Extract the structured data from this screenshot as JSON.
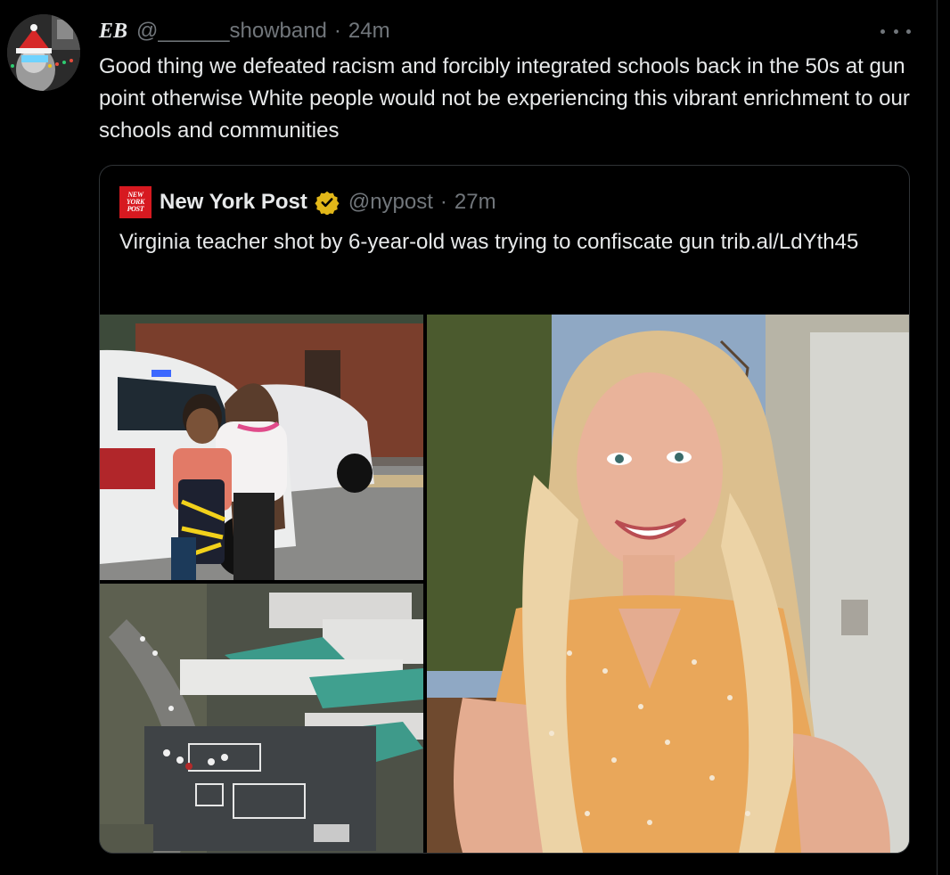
{
  "tweet": {
    "display_name": "EB",
    "handle": "@______showband",
    "separator": "·",
    "time": "24m",
    "text": "Good thing we defeated racism and forcibly integrated schools back in the 50s at gun point otherwise White people would not be experiencing this vibrant enrichment to our schools and communities",
    "avatar_icon": "user-avatar-santa-hat"
  },
  "quote": {
    "display_name": "New York Post",
    "logo_lines": [
      "NEW",
      "YORK",
      "POST"
    ],
    "verified_icon": "verified-badge-icon",
    "handle": "@nypost",
    "separator": "·",
    "time": "27m",
    "text": "Virginia teacher shot by 6-year-old was trying to confiscate gun trib.al/LdYth45"
  },
  "media": [
    {
      "name": "police-scene-photo"
    },
    {
      "name": "school-aerial-photo"
    },
    {
      "name": "teacher-portrait-photo"
    }
  ],
  "colors": {
    "background": "#000000",
    "text_primary": "#e7e9ea",
    "text_secondary": "#71767b",
    "border": "#2f3336",
    "nypost_red": "#d71920",
    "verified_gold": "#e2b719"
  }
}
